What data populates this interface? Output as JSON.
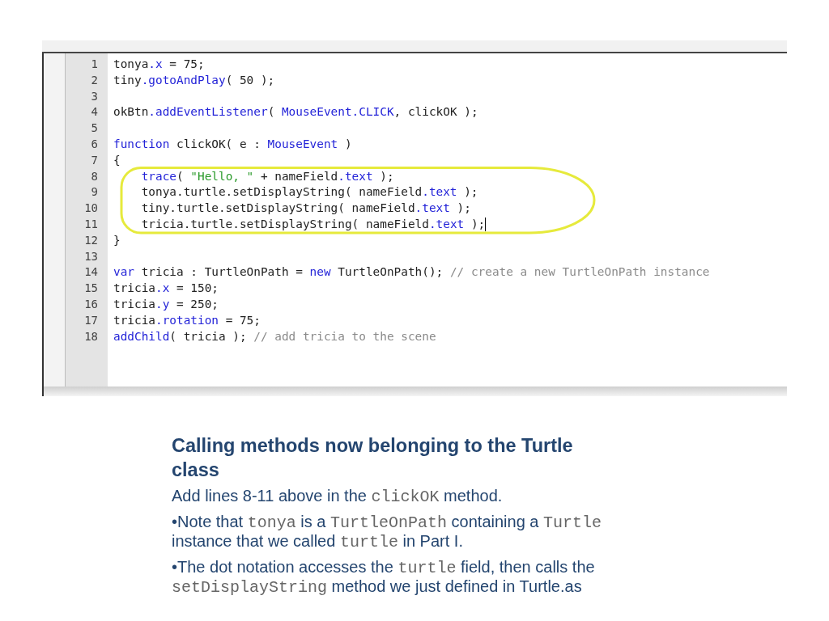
{
  "editor": {
    "lines": [
      {
        "number": "1",
        "cursor": false,
        "tokens": [
          {
            "kind": "plain",
            "text": "tonya"
          },
          {
            "kind": "member",
            "text": ".x"
          },
          {
            "kind": "plain",
            "text": " = 75;"
          }
        ]
      },
      {
        "number": "2",
        "cursor": false,
        "tokens": [
          {
            "kind": "plain",
            "text": "tiny"
          },
          {
            "kind": "member",
            "text": ".gotoAndPlay"
          },
          {
            "kind": "plain",
            "text": "( 50 );"
          }
        ]
      },
      {
        "number": "3",
        "cursor": false
      },
      {
        "number": "4",
        "cursor": false,
        "tokens": [
          {
            "kind": "plain",
            "text": "okBtn"
          },
          {
            "kind": "member",
            "text": ".addEventListener"
          },
          {
            "kind": "plain",
            "text": "( "
          },
          {
            "kind": "member",
            "text": "MouseEvent.CLICK"
          },
          {
            "kind": "plain",
            "text": ", clickOK );"
          }
        ]
      },
      {
        "number": "5",
        "cursor": false
      },
      {
        "number": "6",
        "cursor": false,
        "tokens": [
          {
            "kind": "keyword",
            "text": "function"
          },
          {
            "kind": "plain",
            "text": " clickOK( e : "
          },
          {
            "kind": "member",
            "text": "MouseEvent"
          },
          {
            "kind": "plain",
            "text": " )"
          }
        ]
      },
      {
        "number": "7",
        "cursor": false,
        "tokens": [
          {
            "kind": "plain",
            "text": "{"
          }
        ]
      },
      {
        "number": "8",
        "cursor": false,
        "tokens": [
          {
            "kind": "member",
            "text": "    trace"
          },
          {
            "kind": "plain",
            "text": "( "
          },
          {
            "kind": "string",
            "text": "\"Hello, \""
          },
          {
            "kind": "plain",
            "text": " + nameField"
          },
          {
            "kind": "member",
            "text": ".text"
          },
          {
            "kind": "plain",
            "text": " );"
          }
        ]
      },
      {
        "number": "9",
        "cursor": false,
        "tokens": [
          {
            "kind": "plain",
            "text": "    tonya.turtle.setDisplayString( nameField"
          },
          {
            "kind": "member",
            "text": ".text"
          },
          {
            "kind": "plain",
            "text": " );"
          }
        ]
      },
      {
        "number": "10",
        "cursor": false,
        "tokens": [
          {
            "kind": "plain",
            "text": "    tiny.turtle.setDisplayString( nameField"
          },
          {
            "kind": "member",
            "text": ".text"
          },
          {
            "kind": "plain",
            "text": " );"
          }
        ]
      },
      {
        "number": "11",
        "cursor": true,
        "tokens": [
          {
            "kind": "plain",
            "text": "    tricia.turtle.setDisplayString( nameField"
          },
          {
            "kind": "member",
            "text": ".text"
          },
          {
            "kind": "plain",
            "text": " );"
          }
        ]
      },
      {
        "number": "12",
        "cursor": false,
        "tokens": [
          {
            "kind": "plain",
            "text": "}"
          }
        ]
      },
      {
        "number": "13",
        "cursor": false
      },
      {
        "number": "14",
        "cursor": false,
        "tokens": [
          {
            "kind": "keyword",
            "text": "var"
          },
          {
            "kind": "plain",
            "text": " tricia : TurtleOnPath = "
          },
          {
            "kind": "keyword",
            "text": "new"
          },
          {
            "kind": "plain",
            "text": " TurtleOnPath(); "
          },
          {
            "kind": "comment",
            "text": "// create a new TurtleOnPath instance"
          }
        ]
      },
      {
        "number": "15",
        "cursor": false,
        "tokens": [
          {
            "kind": "plain",
            "text": "tricia"
          },
          {
            "kind": "member",
            "text": ".x"
          },
          {
            "kind": "plain",
            "text": " = 150;"
          }
        ]
      },
      {
        "number": "16",
        "cursor": false,
        "tokens": [
          {
            "kind": "plain",
            "text": "tricia"
          },
          {
            "kind": "member",
            "text": ".y"
          },
          {
            "kind": "plain",
            "text": " = 250;"
          }
        ]
      },
      {
        "number": "17",
        "cursor": false,
        "tokens": [
          {
            "kind": "plain",
            "text": "tricia"
          },
          {
            "kind": "member",
            "text": ".rotation"
          },
          {
            "kind": "plain",
            "text": " = 75;"
          }
        ]
      },
      {
        "number": "18",
        "cursor": false,
        "tokens": [
          {
            "kind": "keyword",
            "text": "addChild"
          },
          {
            "kind": "plain",
            "text": "( tricia ); "
          },
          {
            "kind": "comment",
            "text": "// add tricia to the scene"
          }
        ]
      }
    ]
  },
  "heading": "Calling methods now belonging to the Turtle class",
  "paragraphs": [
    [
      {
        "kind": "text",
        "text": "Add lines 8-11 above in the "
      },
      {
        "kind": "code",
        "text": "clickOK"
      },
      {
        "kind": "text",
        "text": " method."
      }
    ],
    [
      {
        "kind": "text",
        "text": "•Note that "
      },
      {
        "kind": "code",
        "text": "tonya"
      },
      {
        "kind": "text",
        "text": " is a "
      },
      {
        "kind": "code",
        "text": "TurtleOnPath"
      },
      {
        "kind": "text",
        "text": " containing a "
      },
      {
        "kind": "code",
        "text": "Turtle"
      },
      {
        "kind": "text",
        "text": " instance that we called "
      },
      {
        "kind": "code",
        "text": "turtle"
      },
      {
        "kind": "text",
        "text": " in Part I."
      }
    ],
    [
      {
        "kind": "text",
        "text": "•The dot notation accesses the "
      },
      {
        "kind": "code",
        "text": "turtle"
      },
      {
        "kind": "text",
        "text": " field, then calls the "
      },
      {
        "kind": "code",
        "text": "setDisplayString"
      },
      {
        "kind": "text",
        "text": " method we just defined in Turtle.as"
      }
    ]
  ]
}
